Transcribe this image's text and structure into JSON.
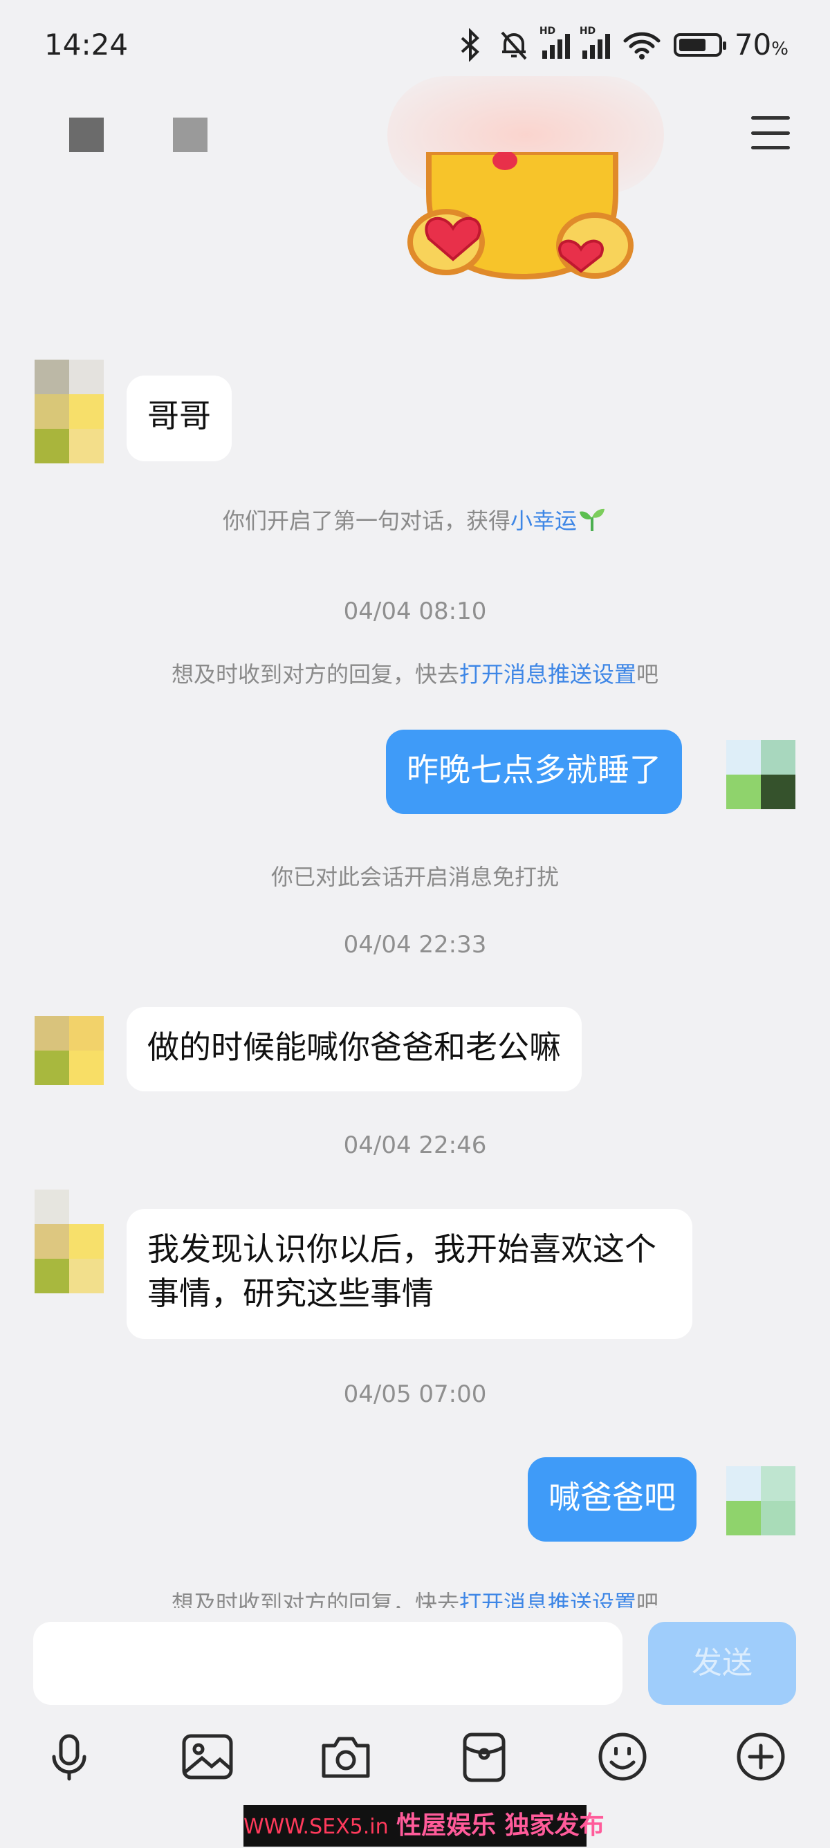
{
  "status_bar": {
    "time": "14:24",
    "battery_percent": "70",
    "percent_sign": "%",
    "network_tag": "HD",
    "battery_level": 0.7
  },
  "header": {
    "menu_icon": "hamburger-menu-icon"
  },
  "sticker": {
    "name": "heart-hands-emoji-sticker"
  },
  "messages": [
    {
      "side": "in",
      "text": "哥哥"
    },
    {
      "side": "out",
      "text": "昨晚七点多就睡了"
    },
    {
      "side": "in",
      "text": "做的时候能喊你爸爸和老公嘛"
    },
    {
      "side": "in",
      "text": "我发现认识你以后，我开始喜欢这个事情，研究这些事情"
    },
    {
      "side": "out",
      "text": "喊爸爸吧"
    }
  ],
  "system": {
    "first_chat_prefix": "你们开启了第一句对话，获得",
    "first_chat_link": "小幸运",
    "first_chat_icon": "sprout-icon",
    "push_prefix": "想及时收到对方的回复，快去",
    "push_link": "打开消息推送设置",
    "push_suffix": "吧",
    "mute_notice": "你已对此会话开启消息免打扰"
  },
  "timestamps": [
    "04/04 08:10",
    "04/04 22:33",
    "04/04 22:46",
    "04/05 07:00"
  ],
  "composer": {
    "send_label": "发送",
    "tools": [
      "microphone-icon",
      "image-icon",
      "camera-icon",
      "red-packet-icon",
      "emoji-icon",
      "plus-icon"
    ]
  },
  "watermark": {
    "url": "WWW.SEX5.in",
    "text": "性屋娱乐 独家发布"
  },
  "colors": {
    "outgoing_bubble": "#3f9bf8",
    "link": "#3d86e6",
    "background": "#f1f1f3"
  }
}
